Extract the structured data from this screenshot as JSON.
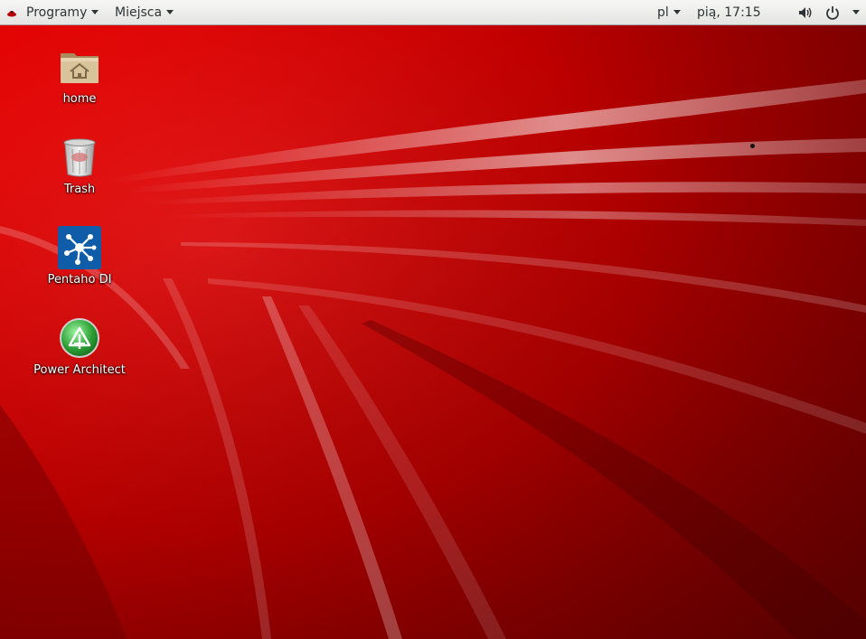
{
  "topbar": {
    "apps_label": "Programy",
    "places_label": "Miejsca",
    "language": "pl",
    "clock": "pią, 17:15",
    "icons": {
      "apps_logo": "redhat-logo-icon",
      "volume": "volume-icon",
      "power": "power-icon",
      "system_menu": "chevron-down-icon"
    }
  },
  "desktop": {
    "icons": [
      {
        "label": "home",
        "icon": "home-folder-icon"
      },
      {
        "label": "Trash",
        "icon": "trash-icon"
      },
      {
        "label": "Pentaho DI",
        "icon": "pentaho-di-icon"
      },
      {
        "label": "Power Architect",
        "icon": "power-architect-icon"
      }
    ]
  },
  "colors": {
    "wallpaper_base": "#c40000",
    "wallpaper_highlight": "#ff5a5a",
    "topbar_bg": "#ededeb",
    "topbar_text": "#2e3436",
    "pentaho_blue": "#0f5da8",
    "architect_green": "#2fa338"
  }
}
